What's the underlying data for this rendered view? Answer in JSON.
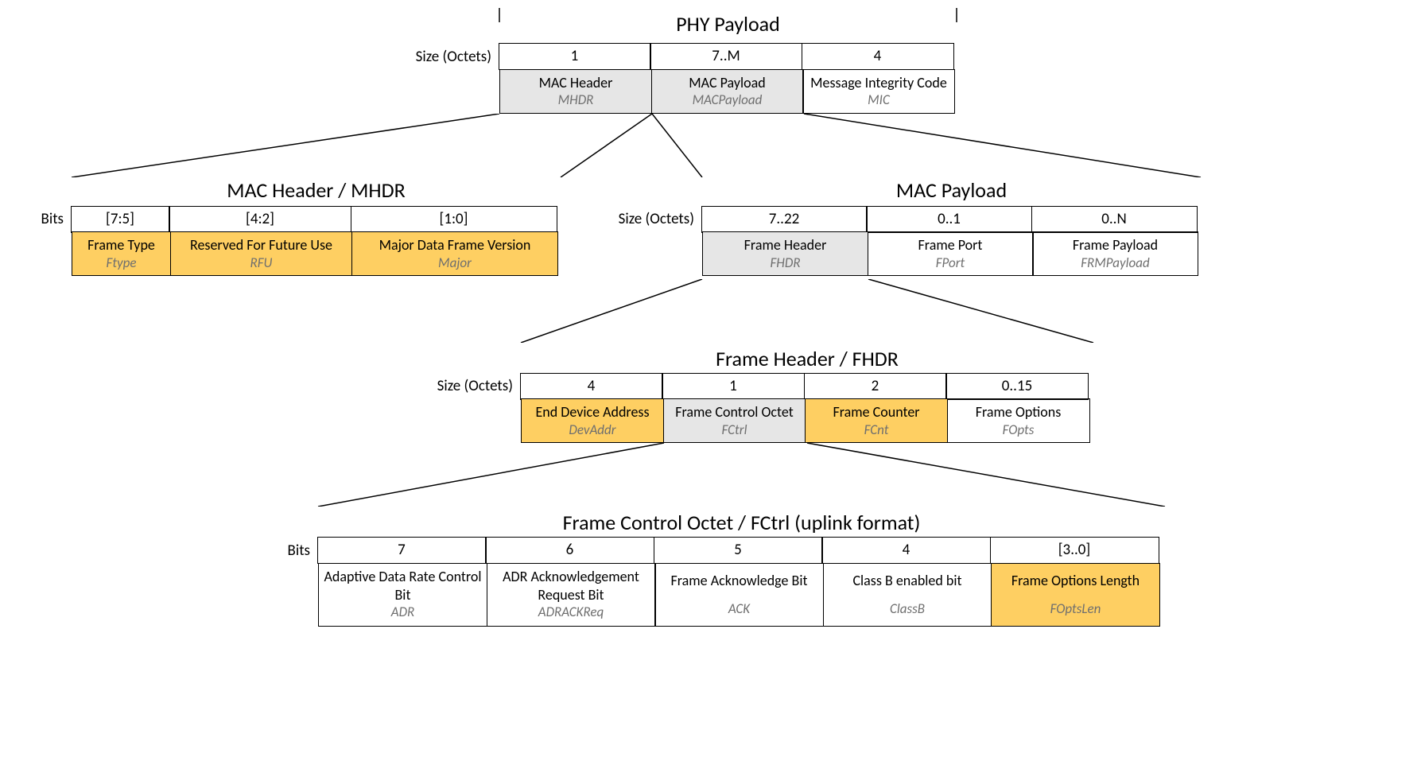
{
  "labels": {
    "size_octets": "Size (Octets)",
    "bits": "Bits"
  },
  "phy": {
    "title": "PHY Payload",
    "cols": [
      {
        "size": "1",
        "name": "MAC Header",
        "sub": "MHDR"
      },
      {
        "size": "7..M",
        "name": "MAC Payload",
        "sub": "MACPayload"
      },
      {
        "size": "4",
        "name": "Message Integrity Code",
        "sub": "MIC"
      }
    ]
  },
  "mhdr": {
    "title": "MAC Header / MHDR",
    "cols": [
      {
        "size": "[7:5]",
        "name": "Frame Type",
        "sub": "Ftype"
      },
      {
        "size": "[4:2]",
        "name": "Reserved For Future Use",
        "sub": "RFU"
      },
      {
        "size": "[1:0]",
        "name": "Major Data Frame Version",
        "sub": "Major"
      }
    ]
  },
  "macpayload": {
    "title": "MAC Payload",
    "cols": [
      {
        "size": "7..22",
        "name": "Frame Header",
        "sub": "FHDR"
      },
      {
        "size": "0..1",
        "name": "Frame Port",
        "sub": "FPort"
      },
      {
        "size": "0..N",
        "name": "Frame Payload",
        "sub": "FRMPayload"
      }
    ]
  },
  "fhdr": {
    "title": "Frame Header / FHDR",
    "cols": [
      {
        "size": "4",
        "name": "End Device Address",
        "sub": "DevAddr"
      },
      {
        "size": "1",
        "name": "Frame Control Octet",
        "sub": "FCtrl"
      },
      {
        "size": "2",
        "name": "Frame Counter",
        "sub": "FCnt"
      },
      {
        "size": "0..15",
        "name": "Frame Options",
        "sub": "FOpts"
      }
    ]
  },
  "fctrl": {
    "title": "Frame Control Octet / FCtrl (uplink format)",
    "cols": [
      {
        "size": "7",
        "name": "Adaptive Data Rate Control Bit",
        "sub": "ADR"
      },
      {
        "size": "6",
        "name": "ADR Acknowledgement Request Bit",
        "sub": "ADRACKReq"
      },
      {
        "size": "5",
        "name": "Frame Acknowledge Bit",
        "sub": "ACK"
      },
      {
        "size": "4",
        "name": "Class B enabled bit",
        "sub": "ClassB"
      },
      {
        "size": "[3..0]",
        "name": "Frame Options Length",
        "sub": "FOptsLen"
      }
    ]
  }
}
